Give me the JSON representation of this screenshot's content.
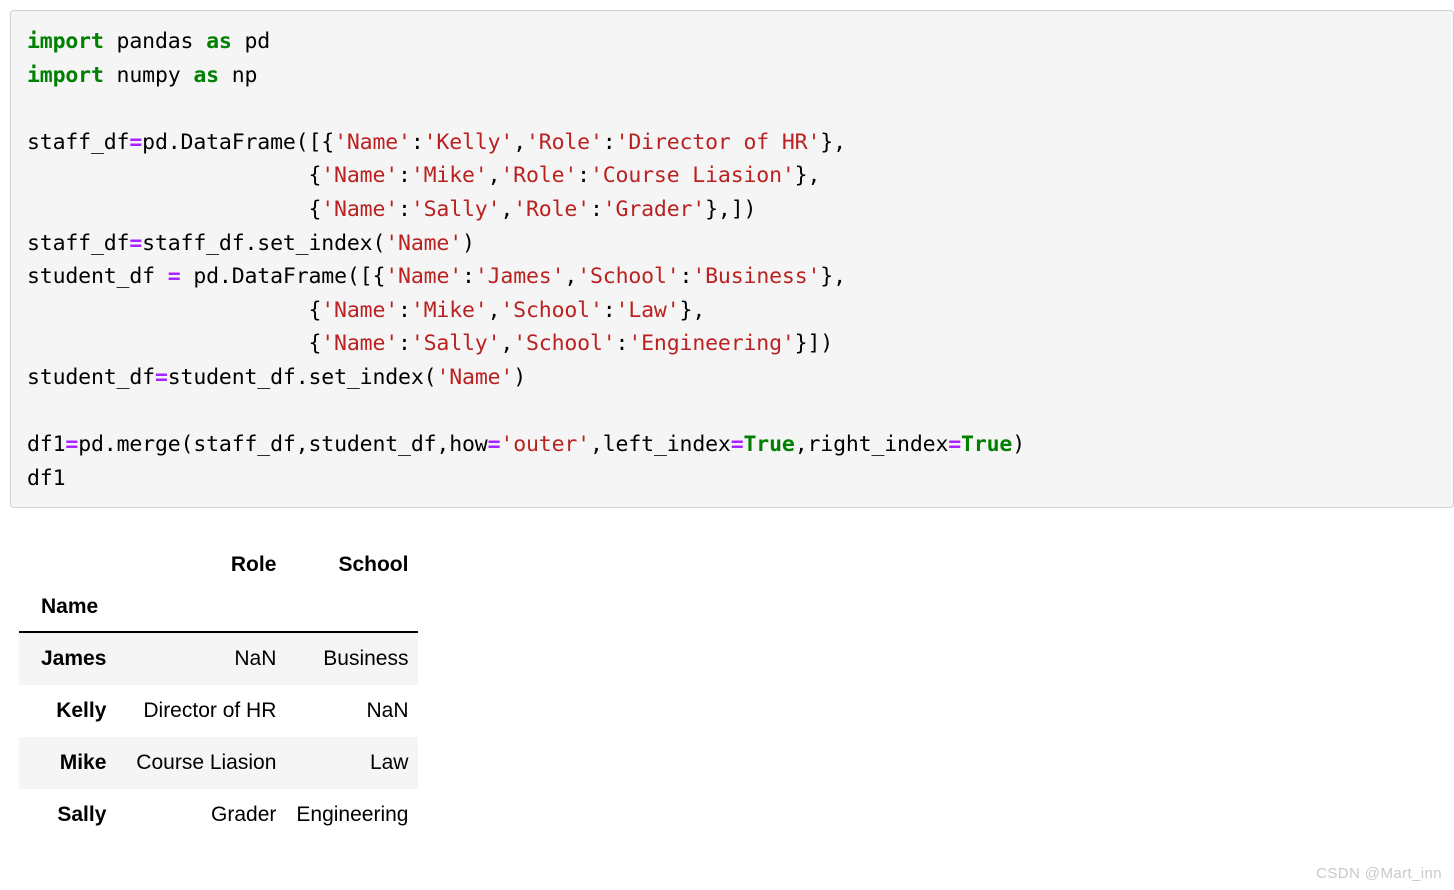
{
  "notebook": {
    "code_cell": {
      "language": "python",
      "background_color": "#f5f5f5",
      "border_color": "#cfcfcf",
      "syntax_colors": {
        "keyword": "#008000",
        "string": "#BA2121",
        "operator": "#AA22FF",
        "plain": "#000000"
      },
      "lines": [
        [
          {
            "t": "import",
            "c": "k"
          },
          {
            "t": " pandas ",
            "c": "n"
          },
          {
            "t": "as",
            "c": "k"
          },
          {
            "t": " pd",
            "c": "n"
          }
        ],
        [
          {
            "t": "import",
            "c": "k"
          },
          {
            "t": " numpy ",
            "c": "n"
          },
          {
            "t": "as",
            "c": "k"
          },
          {
            "t": " np",
            "c": "n"
          }
        ],
        [
          {
            "t": "",
            "c": "n"
          }
        ],
        [
          {
            "t": "staff_df",
            "c": "n"
          },
          {
            "t": "=",
            "c": "o"
          },
          {
            "t": "pd.DataFrame([{",
            "c": "n"
          },
          {
            "t": "'Name'",
            "c": "s"
          },
          {
            "t": ":",
            "c": "n"
          },
          {
            "t": "'Kelly'",
            "c": "s"
          },
          {
            "t": ",",
            "c": "n"
          },
          {
            "t": "'Role'",
            "c": "s"
          },
          {
            "t": ":",
            "c": "n"
          },
          {
            "t": "'Director of HR'",
            "c": "s"
          },
          {
            "t": "},",
            "c": "n"
          }
        ],
        [
          {
            "t": "                      {",
            "c": "n"
          },
          {
            "t": "'Name'",
            "c": "s"
          },
          {
            "t": ":",
            "c": "n"
          },
          {
            "t": "'Mike'",
            "c": "s"
          },
          {
            "t": ",",
            "c": "n"
          },
          {
            "t": "'Role'",
            "c": "s"
          },
          {
            "t": ":",
            "c": "n"
          },
          {
            "t": "'Course Liasion'",
            "c": "s"
          },
          {
            "t": "},",
            "c": "n"
          }
        ],
        [
          {
            "t": "                      {",
            "c": "n"
          },
          {
            "t": "'Name'",
            "c": "s"
          },
          {
            "t": ":",
            "c": "n"
          },
          {
            "t": "'Sally'",
            "c": "s"
          },
          {
            "t": ",",
            "c": "n"
          },
          {
            "t": "'Role'",
            "c": "s"
          },
          {
            "t": ":",
            "c": "n"
          },
          {
            "t": "'Grader'",
            "c": "s"
          },
          {
            "t": "},])",
            "c": "n"
          }
        ],
        [
          {
            "t": "staff_df",
            "c": "n"
          },
          {
            "t": "=",
            "c": "o"
          },
          {
            "t": "staff_df.set_index(",
            "c": "n"
          },
          {
            "t": "'Name'",
            "c": "s"
          },
          {
            "t": ")",
            "c": "n"
          }
        ],
        [
          {
            "t": "student_df ",
            "c": "n"
          },
          {
            "t": "=",
            "c": "o"
          },
          {
            "t": " pd.DataFrame([{",
            "c": "n"
          },
          {
            "t": "'Name'",
            "c": "s"
          },
          {
            "t": ":",
            "c": "n"
          },
          {
            "t": "'James'",
            "c": "s"
          },
          {
            "t": ",",
            "c": "n"
          },
          {
            "t": "'School'",
            "c": "s"
          },
          {
            "t": ":",
            "c": "n"
          },
          {
            "t": "'Business'",
            "c": "s"
          },
          {
            "t": "},",
            "c": "n"
          }
        ],
        [
          {
            "t": "                      {",
            "c": "n"
          },
          {
            "t": "'Name'",
            "c": "s"
          },
          {
            "t": ":",
            "c": "n"
          },
          {
            "t": "'Mike'",
            "c": "s"
          },
          {
            "t": ",",
            "c": "n"
          },
          {
            "t": "'School'",
            "c": "s"
          },
          {
            "t": ":",
            "c": "n"
          },
          {
            "t": "'Law'",
            "c": "s"
          },
          {
            "t": "},",
            "c": "n"
          }
        ],
        [
          {
            "t": "                      {",
            "c": "n"
          },
          {
            "t": "'Name'",
            "c": "s"
          },
          {
            "t": ":",
            "c": "n"
          },
          {
            "t": "'Sally'",
            "c": "s"
          },
          {
            "t": ",",
            "c": "n"
          },
          {
            "t": "'School'",
            "c": "s"
          },
          {
            "t": ":",
            "c": "n"
          },
          {
            "t": "'Engineering'",
            "c": "s"
          },
          {
            "t": "}])",
            "c": "n"
          }
        ],
        [
          {
            "t": "student_df",
            "c": "n"
          },
          {
            "t": "=",
            "c": "o"
          },
          {
            "t": "student_df.set_index(",
            "c": "n"
          },
          {
            "t": "'Name'",
            "c": "s"
          },
          {
            "t": ")",
            "c": "n"
          }
        ],
        [
          {
            "t": "",
            "c": "n"
          }
        ],
        [
          {
            "t": "df1",
            "c": "n"
          },
          {
            "t": "=",
            "c": "o"
          },
          {
            "t": "pd.merge(staff_df,student_df,how",
            "c": "n"
          },
          {
            "t": "=",
            "c": "o"
          },
          {
            "t": "'outer'",
            "c": "s"
          },
          {
            "t": ",left_index",
            "c": "n"
          },
          {
            "t": "=",
            "c": "o"
          },
          {
            "t": "True",
            "c": "k"
          },
          {
            "t": ",right_index",
            "c": "n"
          },
          {
            "t": "=",
            "c": "o"
          },
          {
            "t": "True",
            "c": "k"
          },
          {
            "t": ")",
            "c": "n"
          }
        ],
        [
          {
            "t": "df1",
            "c": "n"
          }
        ]
      ]
    },
    "output_table": {
      "index_name": "Name",
      "columns": [
        "Role",
        "School"
      ],
      "rows": [
        {
          "index": "James",
          "Role": "NaN",
          "School": "Business"
        },
        {
          "index": "Kelly",
          "Role": "Director of HR",
          "School": "NaN"
        },
        {
          "index": "Mike",
          "Role": "Course Liasion",
          "School": "Law"
        },
        {
          "index": "Sally",
          "Role": "Grader",
          "School": "Engineering"
        }
      ],
      "stripe_color": "#f5f5f5",
      "header_rule_color": "#000000"
    }
  },
  "watermark": {
    "text": "CSDN @Mart_inn",
    "color": "#c9c9c9"
  }
}
